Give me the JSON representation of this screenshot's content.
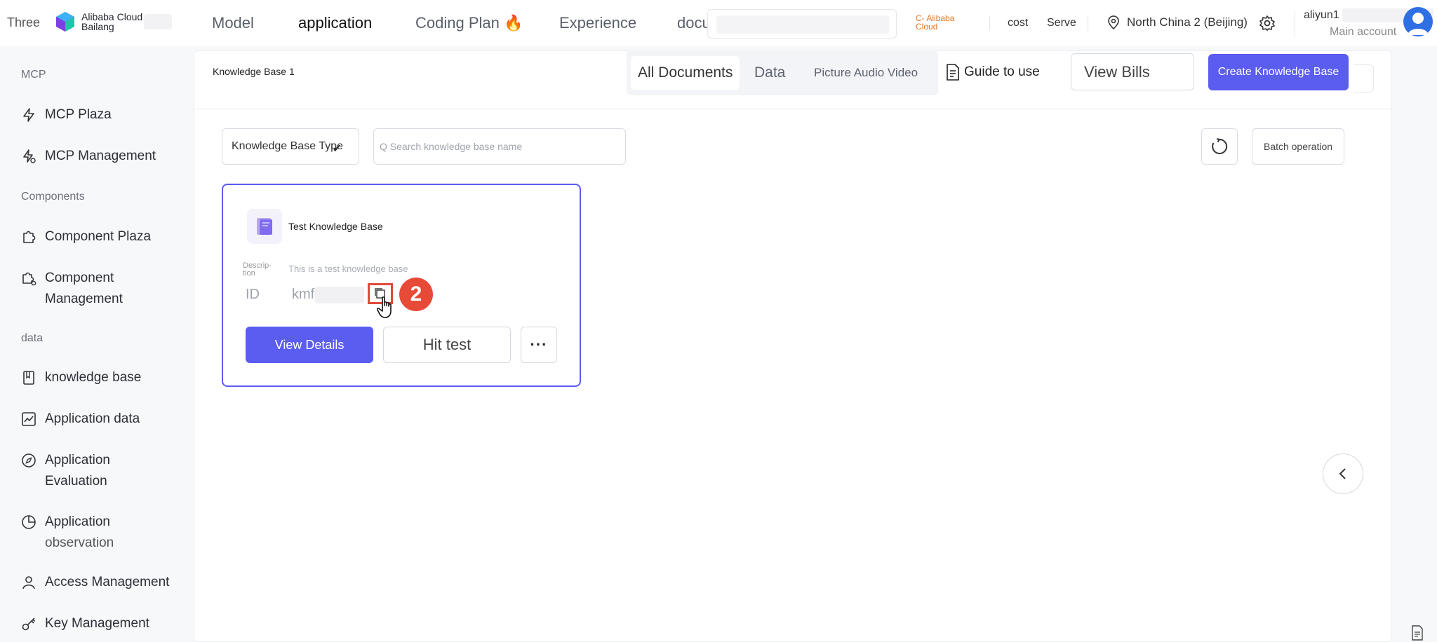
{
  "topbar": {
    "three_label": "Three",
    "brand_line1": "Alibaba Cloud",
    "brand_line2": "Bailang",
    "nav": [
      "Model",
      "application",
      "Coding Plan 🔥",
      "Experience",
      "docu"
    ],
    "nav_active": "application",
    "c_alibaba_cloud": "C- Alibaba Cloud",
    "cost_label": "cost",
    "serve_label": "Serve",
    "region": "North China 2 (Beijing)",
    "account_name": "aliyun1",
    "account_type": "Main account"
  },
  "sidebar": {
    "groups": {
      "mcp": "MCP",
      "components": "Components",
      "data": "data"
    },
    "items": {
      "mcp_plaza": "MCP Plaza",
      "mcp_management": "MCP Management",
      "component_plaza": "Component Plaza",
      "component_management_1": "Component",
      "component_management_2": "Management",
      "knowledge_base": "knowledge base",
      "application_data": "Application data",
      "application_evaluation_1": "Application",
      "application_evaluation_2": "Evaluation",
      "application_observation_1": "Application",
      "application_observation_2": "observation",
      "access_management": "Access Management",
      "key_management": "Key Management"
    }
  },
  "header": {
    "title": "Knowledge Base 1",
    "tabs": [
      "All Documents",
      "Data",
      "Picture Audio Video"
    ],
    "active_tab": "All Documents",
    "guide": "Guide to use",
    "view_bills": "View Bills",
    "create": "Create Knowledge Base"
  },
  "filters": {
    "type_select": "Knowledge Base Type",
    "search_placeholder": "Q Search knowledge base name",
    "batch": "Batch operation"
  },
  "card": {
    "name": "Test Knowledge Base",
    "desc_label": "Descrip- tion",
    "description": "This is a test knowledge base",
    "id_label": "ID",
    "id_value": "kmf",
    "step_number": "2",
    "view_details": "View Details",
    "hit_test": "Hit test",
    "more": "···"
  },
  "colors": {
    "accent": "#5b5cf0",
    "annotation_red": "#e84a38",
    "orange_text": "#e0792b"
  }
}
